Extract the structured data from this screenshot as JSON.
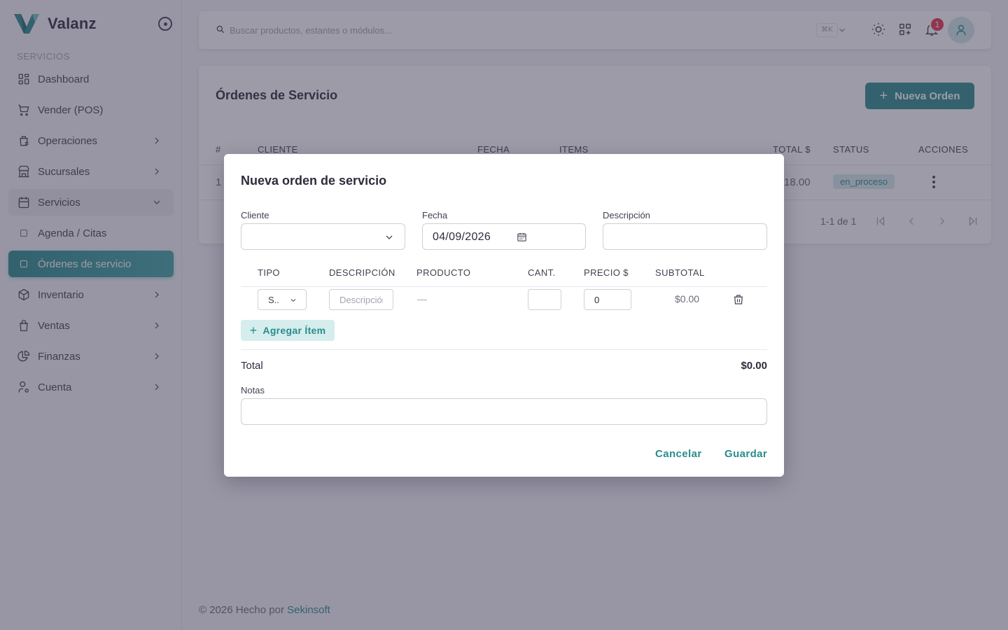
{
  "brand": {
    "name": "Valanz"
  },
  "sidebar": {
    "section_label": "SERVICIOS",
    "items": [
      {
        "label": "Dashboard",
        "icon": "dashboard-icon"
      },
      {
        "label": "Vender (POS)",
        "icon": "cart-icon"
      },
      {
        "label": "Operaciones",
        "icon": "operations-icon"
      },
      {
        "label": "Sucursales",
        "icon": "store-icon"
      },
      {
        "label": "Servicios",
        "icon": "calendar-icon"
      },
      {
        "label": "Agenda / Citas"
      },
      {
        "label": "Órdenes de servicio"
      },
      {
        "label": "Inventario",
        "icon": "box-icon"
      },
      {
        "label": "Ventas",
        "icon": "bag-icon"
      },
      {
        "label": "Finanzas",
        "icon": "pie-chart-icon"
      },
      {
        "label": "Cuenta",
        "icon": "user-settings-icon"
      }
    ]
  },
  "header": {
    "search_placeholder": "Buscar productos, estantes o módulos...",
    "shortcut": "⌘K",
    "notification_count": "1"
  },
  "page": {
    "title": "Órdenes de Servicio",
    "new_button": "Nueva Orden",
    "columns": [
      "#",
      "CLIENTE",
      "FECHA",
      "ITEMS",
      "TOTAL $",
      "STATUS",
      "ACCIONES"
    ],
    "rows": [
      {
        "num": "1",
        "total": "18.00",
        "status": "en_proceso"
      }
    ],
    "pagination": "1-1 de 1"
  },
  "modal": {
    "title": "Nueva orden de servicio",
    "cliente_label": "Cliente",
    "fecha_label": "Fecha",
    "fecha_value": "04/09/2026",
    "descripcion_label": "Descripción",
    "item_columns": [
      "TIPO",
      "DESCRIPCIÓN",
      "PRODUCTO",
      "CANT.",
      "PRECIO $",
      "SUBTOTAL"
    ],
    "item": {
      "tipo": "S..",
      "descripcion_placeholder": "Descripción",
      "producto": "—",
      "cantidad": "",
      "precio": "0",
      "subtotal": "$0.00"
    },
    "add_item": "Agregar Ítem",
    "total_label": "Total",
    "total_value": "$0.00",
    "notas_label": "Notas",
    "cancel": "Cancelar",
    "save": "Guardar"
  },
  "footer": {
    "text": "© 2026 Hecho por ",
    "link": "Sekinsoft"
  },
  "colors": {
    "accent": "#2a8c8c",
    "badge": "#e5344a",
    "status_bg": "#d4ecec"
  }
}
